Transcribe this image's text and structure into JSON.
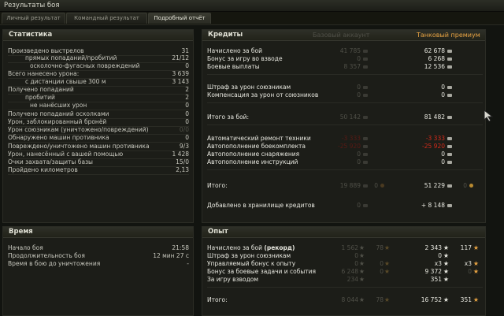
{
  "window_title": "Результаты боя",
  "tabs": [
    "Личный результат",
    "Командный результат",
    "Подробный отчёт"
  ],
  "stats": {
    "title": "Статистика",
    "rows": [
      {
        "label": "Произведено выстрелов",
        "value": "31"
      },
      {
        "label": "прямых попаданий/пробитий",
        "value": "21/12"
      },
      {
        "label": "осколочно-фугасных повреждений",
        "value": "0"
      },
      {
        "label": "Всего нанесено урона:",
        "value": "3 639"
      },
      {
        "label": "с дистанции свыше 300 м",
        "value": "3 143"
      },
      {
        "label": "Получено попаданий",
        "value": "2"
      },
      {
        "label": "пробитий",
        "value": "2"
      },
      {
        "label": "не нанёсших урон",
        "value": "0"
      },
      {
        "label": "Получено попаданий осколками",
        "value": "0"
      },
      {
        "label": "Урон, заблокированный бронёй",
        "value": "0"
      },
      {
        "label": "Урон союзникам (уничтожено/повреждений)",
        "value": "0/0"
      },
      {
        "label": "Обнаружено машин противника",
        "value": "0"
      },
      {
        "label": "Повреждено/уничтожено машин противника",
        "value": "9/3"
      },
      {
        "label": "Урон, нанесённый с вашей помощью",
        "value": "1 428"
      },
      {
        "label": "Очки захвата/защиты базы",
        "value": "15/0"
      },
      {
        "label": "Пройдено километров",
        "value": "2,13"
      }
    ]
  },
  "time": {
    "title": "Время",
    "rows": [
      {
        "label": "Начало боя",
        "value": "21:58"
      },
      {
        "label": "Продолжительность боя",
        "value": "12 мин 27 с"
      },
      {
        "label": "Время в бою до уничтожения",
        "value": "-"
      }
    ]
  },
  "credits": {
    "title": "Кредиты",
    "basic_header": "Базовый аккаунт",
    "premium_header": "Танковый премиум",
    "rows": [
      {
        "label": "Начислено за бой",
        "basic": "41 785",
        "premium": "62 678"
      },
      {
        "label": "Бонус за игру во взводе",
        "basic": "0",
        "premium": "6 268"
      },
      {
        "label": "Боевые выплаты",
        "basic": "8 357",
        "premium": "12 536"
      },
      {
        "label": "Штраф за урон союзникам",
        "basic": "0",
        "premium": "0"
      },
      {
        "label": "Компенсация за урон от союзников",
        "basic": "0",
        "premium": "0"
      },
      {
        "label": "Итого за бой:",
        "basic": "50 142",
        "premium": "81 482"
      },
      {
        "label": "Автоматический ремонт техники",
        "basic": "-3 333",
        "premium": "-3 333"
      },
      {
        "label": "Автопополнение боекомплекта",
        "basic": "-25 920",
        "premium": "-25 920"
      },
      {
        "label": "Автопополнение снаряжения",
        "basic": "0",
        "premium": "0"
      },
      {
        "label": "Автопополнение инструкций",
        "basic": "0",
        "premium": "0"
      },
      {
        "label": "Итого:",
        "basic": "19 889",
        "basic_gold": "0",
        "premium": "51 229",
        "premium_gold": "0"
      },
      {
        "label": "Добавлено в хранилище кредитов",
        "basic": "0",
        "premium": "+ 8 148"
      }
    ]
  },
  "exp": {
    "title": "Опыт",
    "rows": [
      {
        "label": "Начислено за бой",
        "label_bold": "(рекорд)",
        "b1": "1 562",
        "b2": "78",
        "p1": "2 343",
        "p2": "117"
      },
      {
        "label": "Штраф за урон союзникам",
        "b1": "0",
        "p1": "0"
      },
      {
        "label": "Управляемый бонус к опыту",
        "b1": "0",
        "b2": "0",
        "p1": "x3",
        "p2": "x3"
      },
      {
        "label": "Бонус за боевые задачи и события",
        "b1": "6 248",
        "b2": "0",
        "p1": "9 372",
        "p2": "0"
      },
      {
        "label": "За игру взводом",
        "b1": "234",
        "p1": "351"
      },
      {
        "label": "Итого:",
        "b1": "8 044",
        "b2": "78",
        "p1": "16 752",
        "p2": "351"
      }
    ]
  }
}
